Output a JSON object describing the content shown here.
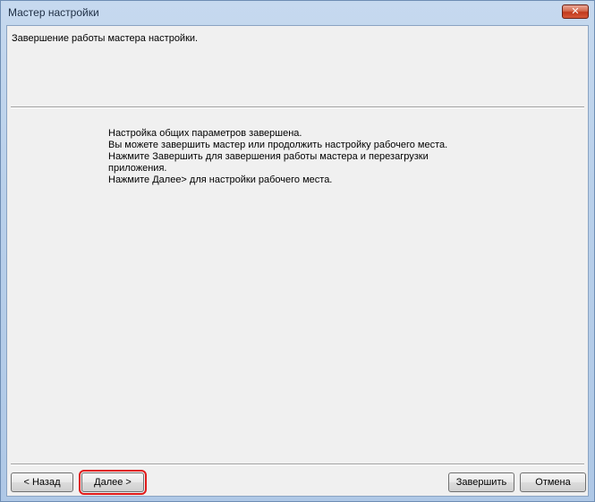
{
  "window": {
    "title": "Мастер настройки",
    "close_glyph": "✕"
  },
  "header": {
    "text": "Завершение работы мастера настройки."
  },
  "message": {
    "lines": [
      "Настройка общих параметров завершена.",
      "Вы можете завершить мастер или продолжить настройку рабочего места.",
      "Нажмите Завершить для завершения работы мастера и перезагрузки",
      "приложения.",
      "Нажмите Далее> для настройки рабочего места."
    ]
  },
  "buttons": {
    "back": "< Назад",
    "next": "Далее >",
    "finish": "Завершить",
    "cancel": "Отмена"
  },
  "colors": {
    "highlight": "#e01b1b",
    "close_button": "#c1391c"
  }
}
